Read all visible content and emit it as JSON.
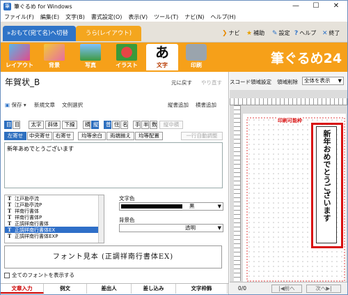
{
  "window": {
    "title": "筆ぐるめ for Windows",
    "min": "—",
    "max": "☐",
    "close": "✕"
  },
  "menu": [
    "ファイル(F)",
    "編集(E)",
    "文字(B)",
    "書式設定(O)",
    "表示(V)",
    "ツール(T)",
    "ナビ(N)",
    "ヘルプ(H)"
  ],
  "tabs": {
    "front": "»おもて(宛て名)へ切替",
    "back": "うら(レイアウト)"
  },
  "top_right": {
    "navi": "ナビ",
    "assist": "補助",
    "settings": "設定",
    "help": "ヘルプ",
    "fullscreen": "終了"
  },
  "toolbar": {
    "items": [
      "レイアウト",
      "背景",
      "写真",
      "イラスト",
      "文字",
      "印刷"
    ],
    "brand": "筆ぐるめ24"
  },
  "doc": {
    "title": "年賀状_B",
    "undo": "元に戻す",
    "redo": "やり直す",
    "save": "保存",
    "new_text": "新規文章",
    "select_text": "文例選択",
    "vertical_add": "縦書追加",
    "horizontal_add": "横書追加"
  },
  "format_row1": [
    "目",
    "目",
    "太字",
    "斜体",
    "下線",
    "横",
    "縦",
    "普",
    "住",
    "名",
    "手",
    "半",
    "数",
    "縦中横"
  ],
  "format_row2": [
    "左寄せ",
    "中央寄せ",
    "右寄せ",
    "均等余白",
    "両端揃え",
    "均等配置",
    "一行自動調整"
  ],
  "text_content": "新年あめでとうございます",
  "fonts": [
    "江戸勘亭流",
    "江戸勘亭流P",
    "祥南行書体",
    "祥南行書体P",
    "正調祥南行書体",
    "正調祥南行書体EX",
    "正調祥南行書体EXP"
  ],
  "selected_font_index": 5,
  "color": {
    "label": "文字色",
    "value": "黒",
    "swatch": "#000000"
  },
  "bgcolor": {
    "label": "背景色",
    "value": "透明"
  },
  "preview": "フォント見本 (正調祥南行書体EX)",
  "show_all_fonts": "全てのフォントを表示する",
  "bottom_tabs": [
    "文章入力",
    "例文",
    "差出人",
    "差し込み",
    "文字枠飾"
  ],
  "right": {
    "barcode": "スコード",
    "area_set": "領域設定",
    "area_del": "領域削除",
    "view": "全体を表示",
    "printable": "印刷可能枠",
    "page": "0/0",
    "prev": "前へ",
    "next": "次へ"
  },
  "vertical_text": "新年おめでとうございます",
  "colors": {
    "accent": "#f6a019",
    "blue": "#2f74c8",
    "red": "#d81010"
  }
}
